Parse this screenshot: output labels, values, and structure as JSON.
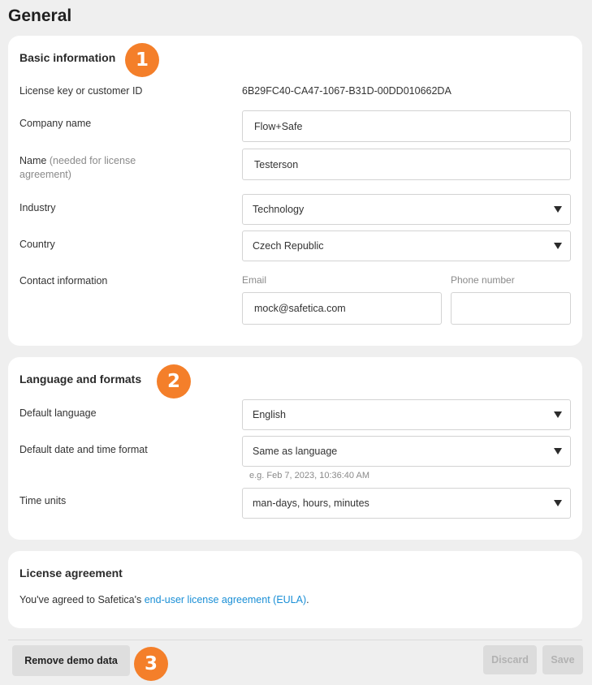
{
  "page": {
    "title": "General"
  },
  "basic": {
    "title": "Basic information",
    "badge": "1",
    "license_label": "License key or customer ID",
    "license_value": "6B29FC40-CA47-1067-B31D-00DD010662DA",
    "company_label": "Company name",
    "company_value": "Flow+Safe",
    "name_label": "Name",
    "name_hint": "(needed for license agreement)",
    "name_value": "Testerson",
    "industry_label": "Industry",
    "industry_value": "Technology",
    "country_label": "Country",
    "country_value": "Czech Republic",
    "contact_label": "Contact information",
    "email_label": "Email",
    "email_value": "mock@safetica.com",
    "phone_label": "Phone number",
    "phone_value": ""
  },
  "language": {
    "title": "Language and formats",
    "badge": "2",
    "default_language_label": "Default language",
    "default_language_value": "English",
    "date_format_label": "Default date and time format",
    "date_format_value": "Same as language",
    "date_format_example": "e.g. Feb 7, 2023, 10:36:40 AM",
    "time_units_label": "Time units",
    "time_units_value": "man-days, hours, minutes"
  },
  "license": {
    "title": "License agreement",
    "text_prefix": "You've agreed to Safetica's ",
    "link_text": "end-user license agreement (EULA)",
    "text_suffix": "."
  },
  "footer": {
    "remove_demo_label": "Remove demo data",
    "badge": "3",
    "discard_label": "Discard",
    "save_label": "Save"
  },
  "colors": {
    "accent_badge": "#f47f2a",
    "link": "#1a8fd6",
    "background": "#efefef"
  }
}
